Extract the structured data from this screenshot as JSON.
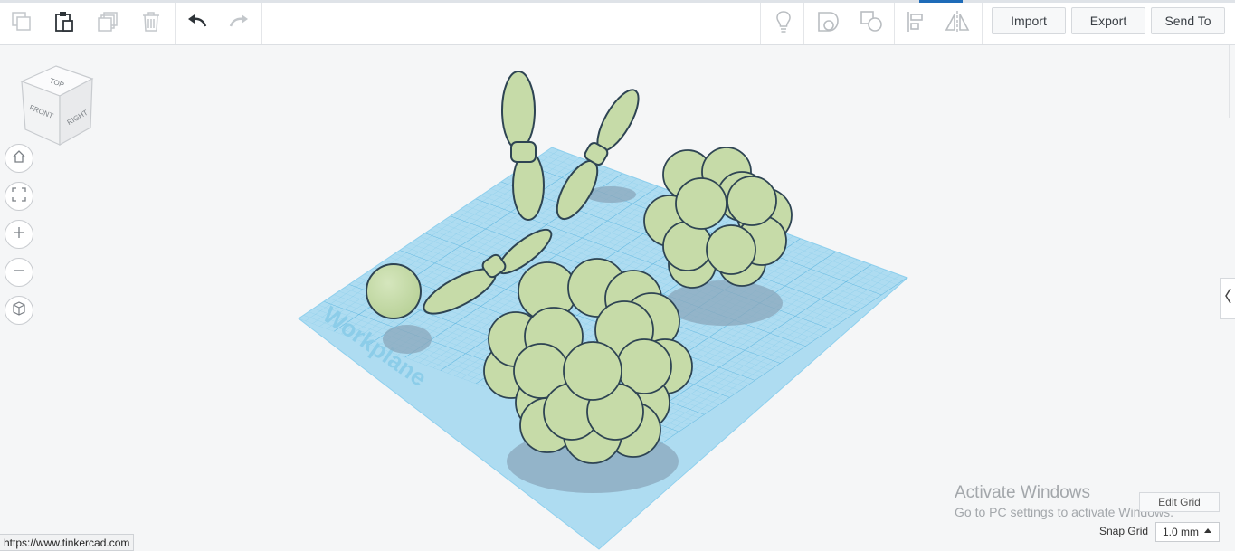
{
  "toolbar": {
    "left_tools": [
      {
        "name": "copy",
        "icon": "copy-icon",
        "enabled": false
      },
      {
        "name": "paste",
        "icon": "paste-icon",
        "enabled": true
      },
      {
        "name": "duplicate",
        "icon": "duplicate-icon",
        "enabled": false
      },
      {
        "name": "delete",
        "icon": "trash-icon",
        "enabled": false
      },
      {
        "name": "undo",
        "icon": "undo-icon",
        "enabled": true
      },
      {
        "name": "redo",
        "icon": "redo-icon",
        "enabled": false
      }
    ],
    "right_tools": [
      {
        "name": "lightbulb",
        "icon": "lightbulb-icon"
      },
      {
        "name": "group",
        "icon": "group-icon"
      },
      {
        "name": "ungroup",
        "icon": "ungroup-icon"
      },
      {
        "name": "align",
        "icon": "align-icon"
      },
      {
        "name": "mirror",
        "icon": "mirror-icon"
      }
    ],
    "import_label": "Import",
    "export_label": "Export",
    "send_to_label": "Send To"
  },
  "view_cube": {
    "top_label": "TOP",
    "front_label": "FRONT",
    "right_label": "RIGHT"
  },
  "nav_controls": [
    {
      "name": "home-view",
      "icon": "home-icon"
    },
    {
      "name": "fit-view",
      "icon": "fit-all-icon"
    },
    {
      "name": "zoom-in",
      "icon": "plus-icon"
    },
    {
      "name": "zoom-out",
      "icon": "minus-icon"
    },
    {
      "name": "ortho-view",
      "icon": "cube-icon"
    }
  ],
  "workplane": {
    "label": "Workplane",
    "grid_color": "#7ec8e8",
    "plane_color": "#a9dcf2"
  },
  "shapes_color": "#c6dba8",
  "shapes_outline": "#2e4453",
  "collapse_icon": "chevron-left-icon",
  "watermark": {
    "title": "Activate Windows",
    "subtitle": "Go to PC settings to activate Windows."
  },
  "edit_grid_label": "Edit Grid",
  "snap_grid": {
    "label": "Snap Grid",
    "value": "1.0 mm"
  },
  "status_url": "https://www.tinkercad.com"
}
